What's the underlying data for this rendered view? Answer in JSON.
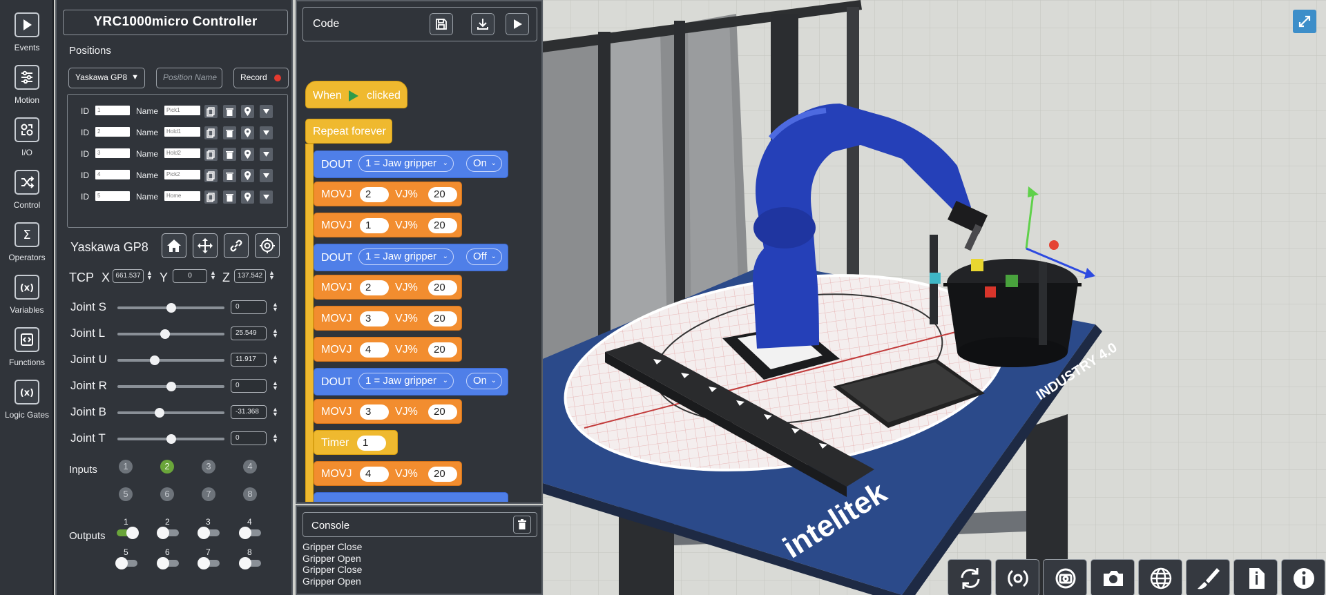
{
  "sidebar": {
    "items": [
      {
        "label": "Events",
        "icon": "play-icon"
      },
      {
        "label": "Motion",
        "icon": "sliders-icon"
      },
      {
        "label": "I/O",
        "icon": "io-icon"
      },
      {
        "label": "Control",
        "icon": "shuffle-icon"
      },
      {
        "label": "Operators",
        "icon": "sigma-icon"
      },
      {
        "label": "Variables",
        "icon": "variables-icon"
      },
      {
        "label": "Functions",
        "icon": "functions-icon"
      },
      {
        "label": "Logic Gates",
        "icon": "logic-gates-icon"
      }
    ]
  },
  "controller": {
    "title": "YRC1000micro Controller",
    "positions_label": "Positions",
    "robot_select": "Yaskawa GP8",
    "position_name_placeholder": "Position Name",
    "record_label": "Record",
    "positions": [
      {
        "id_label": "ID",
        "id": "1",
        "name_label": "Name",
        "name": "Pick1"
      },
      {
        "id_label": "ID",
        "id": "2",
        "name_label": "Name",
        "name": "Hold1"
      },
      {
        "id_label": "ID",
        "id": "3",
        "name_label": "Name",
        "name": "Hold2"
      },
      {
        "id_label": "ID",
        "id": "4",
        "name_label": "Name",
        "name": "Pick2"
      },
      {
        "id_label": "ID",
        "id": "5",
        "name_label": "Name",
        "name": "Home"
      }
    ],
    "robot_name": "Yaskawa GP8",
    "tcp": {
      "label": "TCP",
      "x_label": "X",
      "x": "661.537",
      "y_label": "Y",
      "y": "0",
      "z_label": "Z",
      "z": "137.542"
    },
    "joints": [
      {
        "label": "Joint S",
        "value": "0",
        "fraction": 0.5
      },
      {
        "label": "Joint L",
        "value": "25.549",
        "fraction": 0.44
      },
      {
        "label": "Joint U",
        "value": "11.917",
        "fraction": 0.33
      },
      {
        "label": "Joint R",
        "value": "0",
        "fraction": 0.5
      },
      {
        "label": "Joint B",
        "value": "-31.368",
        "fraction": 0.38
      },
      {
        "label": "Joint T",
        "value": "0",
        "fraction": 0.5
      }
    ],
    "inputs_label": "Inputs",
    "inputs": [
      "1",
      "2",
      "3",
      "4",
      "5",
      "6",
      "7",
      "8"
    ],
    "outputs_label": "Outputs",
    "outputs": [
      "1",
      "2",
      "3",
      "4",
      "5",
      "6",
      "7",
      "8"
    ]
  },
  "code": {
    "title": "Code",
    "blocks": {
      "when": "When",
      "clicked": "clicked",
      "repeat": "Repeat forever",
      "dout": "DOUT",
      "movj": "MOVJ",
      "vj": "VJ%",
      "timer": "Timer",
      "jaw": "1 = Jaw gripper",
      "on": "On",
      "off": "Off",
      "m1a": "2",
      "m1b": "20",
      "m2a": "1",
      "m2b": "20",
      "m3a": "2",
      "m3b": "20",
      "m4a": "3",
      "m4b": "20",
      "m5a": "4",
      "m5b": "20",
      "m6a": "3",
      "m6b": "20",
      "t1": "1",
      "m7a": "4",
      "m7b": "20"
    }
  },
  "console": {
    "title": "Console",
    "lines": [
      "Gripper Close",
      "Gripper Open",
      "Gripper Close",
      "Gripper Open"
    ]
  },
  "scene": {
    "brand_text": "intelitek",
    "industry_text": "INDUSTRY 4.0",
    "toolbar": [
      "reset-icon",
      "rotate-icon",
      "camera-rotate-icon",
      "camera-icon",
      "grid-globe-icon",
      "brush-icon",
      "document-icon",
      "info-icon"
    ]
  },
  "colors": {
    "panel": "#30343a",
    "accent_green": "#6aa53a",
    "block_orange": "#f28d2f",
    "block_blue": "#4f7fe8",
    "block_yellow": "#efb92f",
    "robot_blue": "#2540b8"
  }
}
